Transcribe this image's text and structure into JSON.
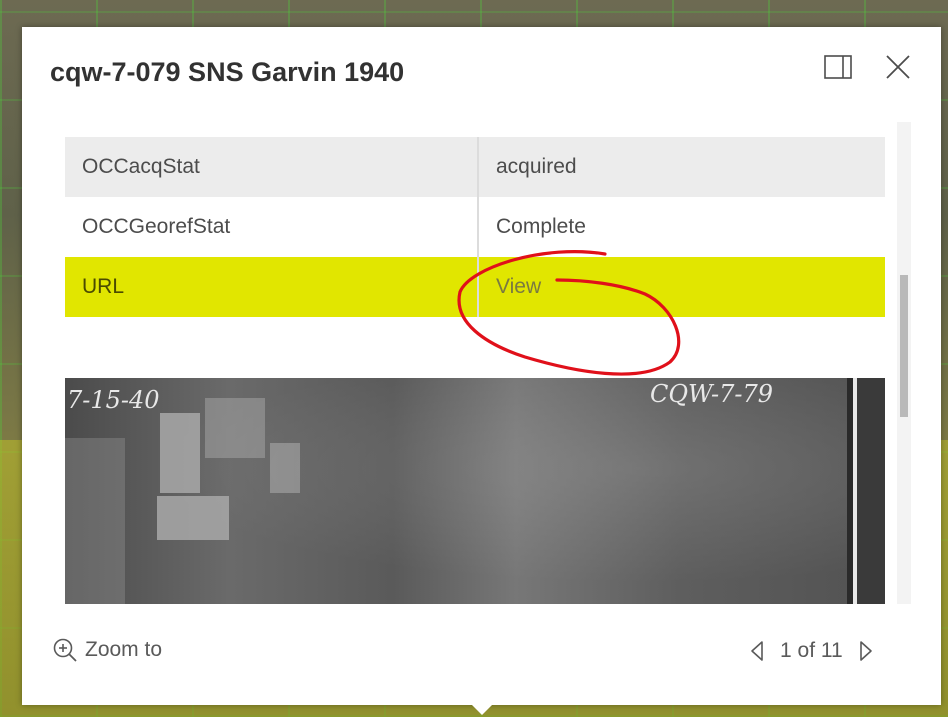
{
  "popup": {
    "title": "cqw-7-079 SNS Garvin 1940",
    "dock_icon": "dock-icon",
    "close_icon": "close-icon"
  },
  "attributes": [
    {
      "key": "OCCacqStat",
      "value": "acquired"
    },
    {
      "key": "OCCGeorefStat",
      "value": "Complete"
    },
    {
      "key": "URL",
      "value": "View"
    }
  ],
  "photo": {
    "date_label": "7-15-40",
    "id_label": "CQW-7-79"
  },
  "footer": {
    "zoom_label": "Zoom to",
    "zoom_icon": "zoom-in-icon",
    "pager_text": "1 of 11",
    "prev_icon": "triangle-left-icon",
    "next_icon": "triangle-right-icon"
  },
  "colors": {
    "highlight": "#e1e600",
    "annotation": "#e0101a",
    "row_alt": "#ececec"
  }
}
